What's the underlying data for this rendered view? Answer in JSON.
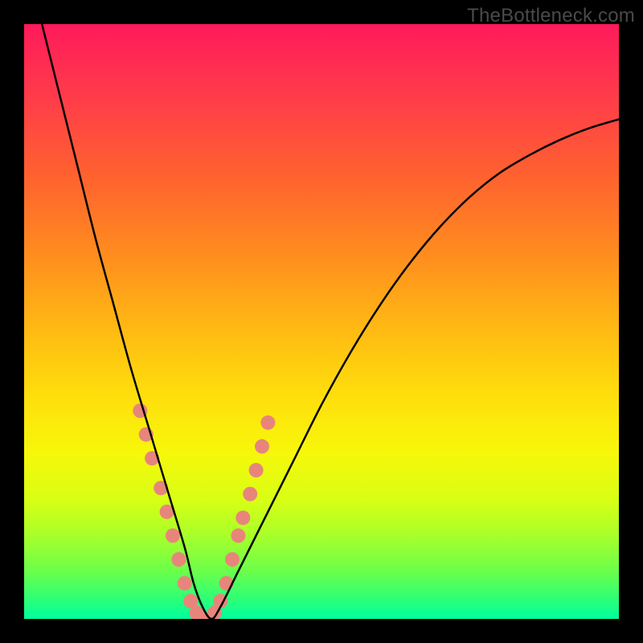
{
  "watermark": "TheBottleneck.com",
  "chart_data": {
    "type": "line",
    "title": "",
    "xlabel": "",
    "ylabel": "",
    "xlim": [
      0,
      100
    ],
    "ylim": [
      0,
      100
    ],
    "grid": false,
    "legend": false,
    "series": [
      {
        "name": "bottleneck-curve",
        "color": "#000000",
        "x": [
          3,
          6,
          9,
          12,
          15,
          18,
          21,
          24,
          27,
          28.5,
          30,
          31.5,
          33,
          36,
          40,
          45,
          50,
          55,
          60,
          65,
          70,
          75,
          80,
          85,
          90,
          95,
          100
        ],
        "y": [
          100,
          88,
          76,
          64,
          53,
          42,
          32,
          22,
          12,
          6,
          2,
          0,
          2,
          8,
          16,
          26,
          36,
          45,
          53,
          60,
          66,
          71,
          75,
          78,
          80.5,
          82.5,
          84
        ]
      }
    ],
    "markers": {
      "name": "highlight-dots",
      "color": "#e8857a",
      "radius": 9,
      "x": [
        19.5,
        20.5,
        21.5,
        23.0,
        24.0,
        25.0,
        26.0,
        27.0,
        28.0,
        29.0,
        30.0,
        31.0,
        32.0,
        33.0,
        34.0,
        35.0,
        36.0,
        36.8,
        38.0,
        39.0,
        40.0,
        41.0
      ],
      "y": [
        35.0,
        31.0,
        27.0,
        22.0,
        18.0,
        14.0,
        10.0,
        6.0,
        3.0,
        1.0,
        0.0,
        0.0,
        1.0,
        3.0,
        6.0,
        10.0,
        14.0,
        17.0,
        21.0,
        25.0,
        29.0,
        33.0
      ]
    }
  }
}
